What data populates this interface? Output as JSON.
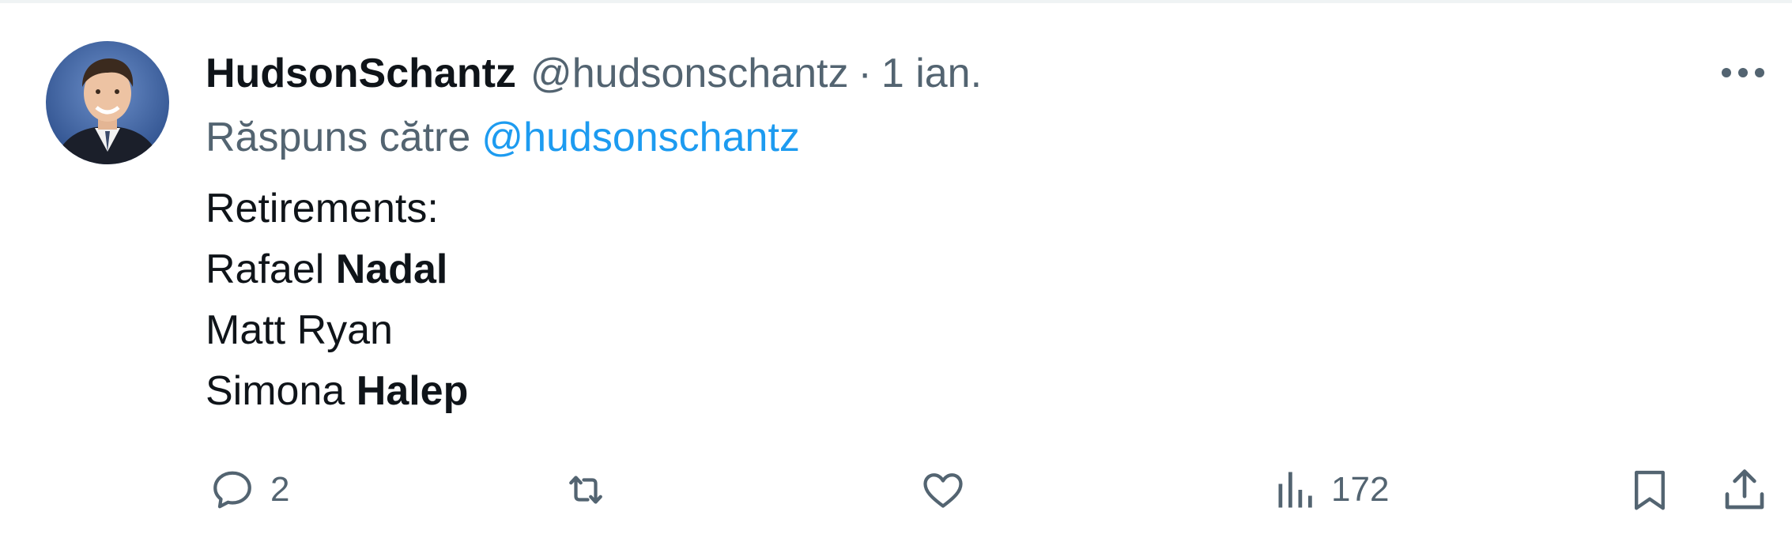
{
  "tweet": {
    "display_name": "HudsonSchantz",
    "handle": "@hudsonschantz",
    "separator": "·",
    "timestamp": "1 ian.",
    "reply_prefix": "Răspuns către",
    "reply_mention": "@hudsonschantz",
    "lines": [
      {
        "parts": [
          {
            "text": "Retirements:",
            "bold": false
          }
        ]
      },
      {
        "parts": [
          {
            "text": "Rafael ",
            "bold": false
          },
          {
            "text": "Nadal",
            "bold": true
          }
        ]
      },
      {
        "parts": [
          {
            "text": "Matt Ryan",
            "bold": false
          }
        ]
      },
      {
        "parts": [
          {
            "text": "Simona ",
            "bold": false
          },
          {
            "text": "Halep",
            "bold": true
          }
        ]
      }
    ]
  },
  "actions": {
    "reply": {
      "icon": "reply-icon",
      "count": "2"
    },
    "retweet": {
      "icon": "retweet-icon",
      "count": ""
    },
    "like": {
      "icon": "heart-icon",
      "count": ""
    },
    "views": {
      "icon": "views-icon",
      "count": "172"
    },
    "bookmark": {
      "icon": "bookmark-icon"
    },
    "share": {
      "icon": "share-icon"
    }
  },
  "colors": {
    "text_primary": "#0f1419",
    "text_secondary": "#536471",
    "link": "#1d9bf0",
    "divider": "#eff3f4"
  }
}
